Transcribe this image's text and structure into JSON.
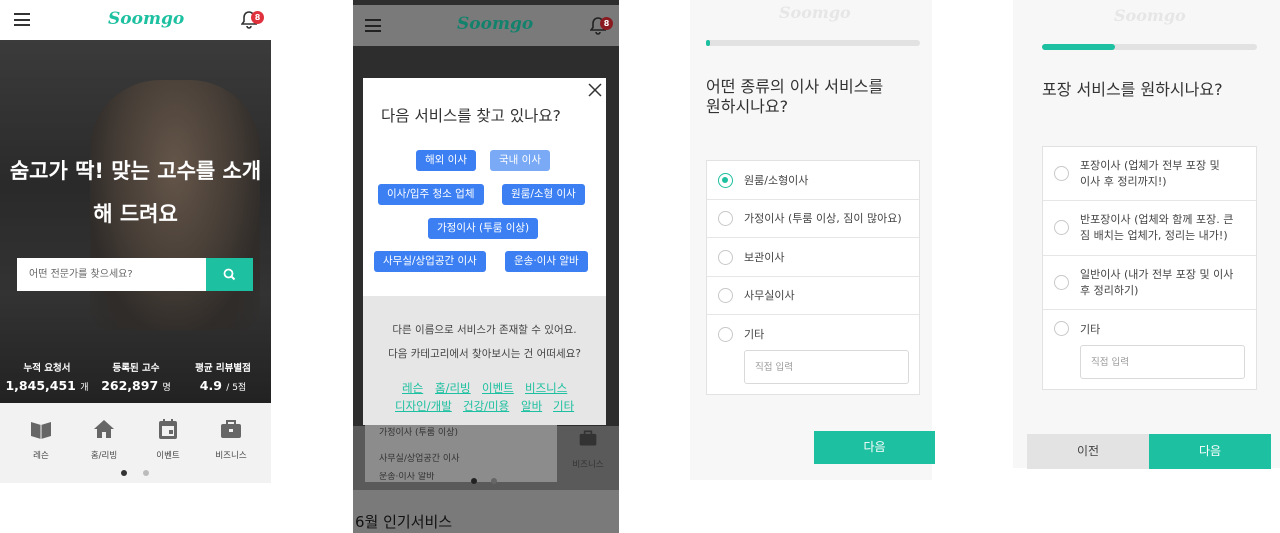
{
  "brand": {
    "logo": "Soomgo",
    "accent": "#1dc0a0",
    "notification_count": "8"
  },
  "panel1": {
    "hero_title_line1": "숨고가 딱! 맞는 고수를 소개",
    "hero_title_line2": "해 드려요",
    "search_placeholder": "어떤 전문가를 찾으세요?",
    "stats": [
      {
        "label": "누적 요청서",
        "value": "1,845,451",
        "unit": "개"
      },
      {
        "label": "등록된 고수",
        "value": "262,897",
        "unit": "명"
      },
      {
        "label": "평균 리뷰별점",
        "value": "4.9",
        "unit": "/ 5점"
      }
    ],
    "categories": [
      {
        "label": "레슨",
        "icon": "book-icon"
      },
      {
        "label": "홈/리빙",
        "icon": "home-icon"
      },
      {
        "label": "이벤트",
        "icon": "calendar-icon"
      },
      {
        "label": "비즈니스",
        "icon": "briefcase-icon"
      }
    ]
  },
  "panel2": {
    "modal_question": "다음 서비스를 찾고 있나요?",
    "chips": [
      "해외 이사",
      "국내 이사",
      "이사/입주 청소 업체",
      "원룸/소형 이사",
      "가정이사 (투룸 이상)",
      "사무실/상업공간 이사",
      "운송·이사 알바"
    ],
    "note_line1": "다른 이름으로 서비스가 존재할 수 있어요.",
    "note_line2": "다음 카테고리에서 찾아보시는 건 어떠세요?",
    "links": [
      "레슨",
      "홈/리빙",
      "이벤트",
      "비즈니스",
      "디자인/개발",
      "건강/미용",
      "알바",
      "기타"
    ],
    "behind_items": [
      "가정이사 (투룸 이상)",
      "사무실/상업공간 이사",
      "운송·이사 알바"
    ],
    "behind_icon_label": "비즈니스",
    "footer_heading": "6월 인기서비스"
  },
  "panel3": {
    "progress": 0.02,
    "question_line1": "어떤 종류의 이사 서비스를",
    "question_line2": "원하시나요?",
    "options": [
      "원룸/소형이사",
      "가정이사 (투룸 이상, 짐이 많아요)",
      "보관이사",
      "사무실이사",
      "기타"
    ],
    "selected_option": "원룸/소형이사",
    "direct_placeholder": "직접 입력",
    "next_label": "다음"
  },
  "panel4": {
    "progress": 0.34,
    "question": "포장 서비스를 원하시나요?",
    "options": [
      {
        "line1": "포장이사 (업체가 전부 포장 및",
        "line2": "이사 후 정리까지!)"
      },
      {
        "line1": "반포장이사 (업체와 함께 포장. 큰",
        "line2": "짐 배치는 업체가, 정리는 내가!)"
      },
      {
        "line1": "일반이사 (내가 전부 포장 및 이사",
        "line2": "후 정리하기)"
      },
      {
        "line1": "기타",
        "line2": ""
      }
    ],
    "direct_placeholder": "직접 입력",
    "prev_label": "이전",
    "next_label": "다음"
  }
}
